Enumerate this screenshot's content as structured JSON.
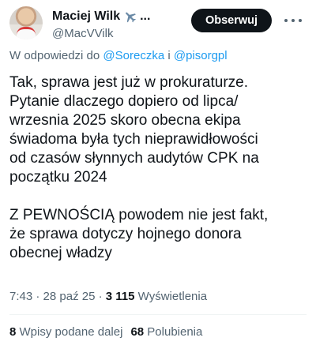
{
  "author": {
    "display_name": "Maciej Wilk",
    "ellipsis": "...",
    "handle": "@MacVVilk",
    "badge_icon": "airplane-icon"
  },
  "follow_button": {
    "label": "Obserwuj"
  },
  "more_menu": {
    "icon": "more-horizontal-icon"
  },
  "reply_context": {
    "prefix": "W odpowiedzi do ",
    "mention_1": "@Soreczka",
    "separator": " i ",
    "mention_2": "@pisorgpl"
  },
  "tweet": {
    "text": "Tak, sprawa jest już w prokuraturze.\nPytanie dlaczego dopiero od lipca/\nwrzesnia 2025 skoro obecna ekipa\nświadoma była tych nieprawidłowości\nod czasów słynnych audytów CPK na\npoczątku 2024\n\nZ PEWNOŚCIĄ powodem nie jest fakt,\nże sprawa dotyczy hojnego donora\nobecnej władzy"
  },
  "meta": {
    "time": "7:43",
    "dot": " · ",
    "date": "28 paź 25",
    "views_count": "3 115",
    "views_label": " Wyświetlenia"
  },
  "stats": {
    "reposts_count": "8",
    "reposts_label": " Wpisy podane dalej",
    "likes_count": "68",
    "likes_label": " Polubienia"
  },
  "colors": {
    "text": "#0f1419",
    "secondary": "#536471",
    "link": "#1d9bf0",
    "button_bg": "#0f1419",
    "divider": "#eff3f4"
  }
}
